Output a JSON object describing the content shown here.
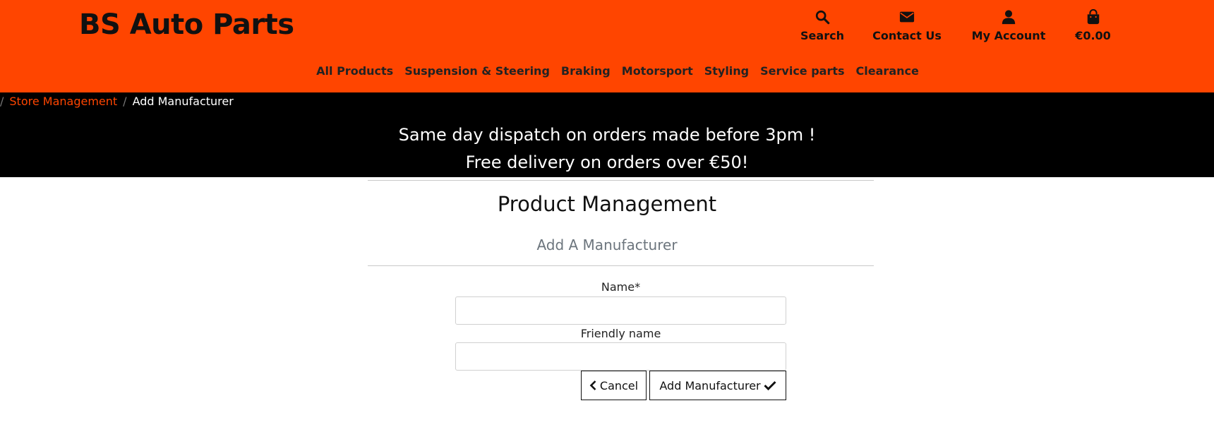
{
  "header": {
    "logo": "BS Auto Parts",
    "utilities": {
      "search": "Search",
      "contact": "Contact Us",
      "account": "My Account",
      "bag_total": "€0.00"
    },
    "nav": [
      "All Products",
      "Suspension & Steering",
      "Braking",
      "Motorsport",
      "Styling",
      "Service parts",
      "Clearance"
    ],
    "background_color": "#ff4500"
  },
  "breadcrumb": {
    "items": [
      {
        "label": "Store Management",
        "link": true
      },
      {
        "label": "Add Manufacturer",
        "link": false
      }
    ]
  },
  "promo": {
    "line1": "Same day dispatch on orders made before 3pm !",
    "line2": "Free delivery on orders over €50!"
  },
  "page": {
    "title": "Product Management",
    "subtitle": "Add A Manufacturer"
  },
  "form": {
    "name_label": "Name*",
    "name_value": "",
    "friendly_label": "Friendly name",
    "friendly_value": "",
    "cancel_label": "Cancel",
    "submit_label": "Add Manufacturer"
  },
  "icons": {
    "search": "search-icon",
    "contact": "envelope-icon",
    "account": "user-icon",
    "bag": "shopping-bag-icon",
    "cancel": "chevron-left-icon",
    "submit": "check-icon"
  },
  "colors": {
    "accent": "#ff4500",
    "band": "#000000",
    "muted": "#6c757d"
  }
}
